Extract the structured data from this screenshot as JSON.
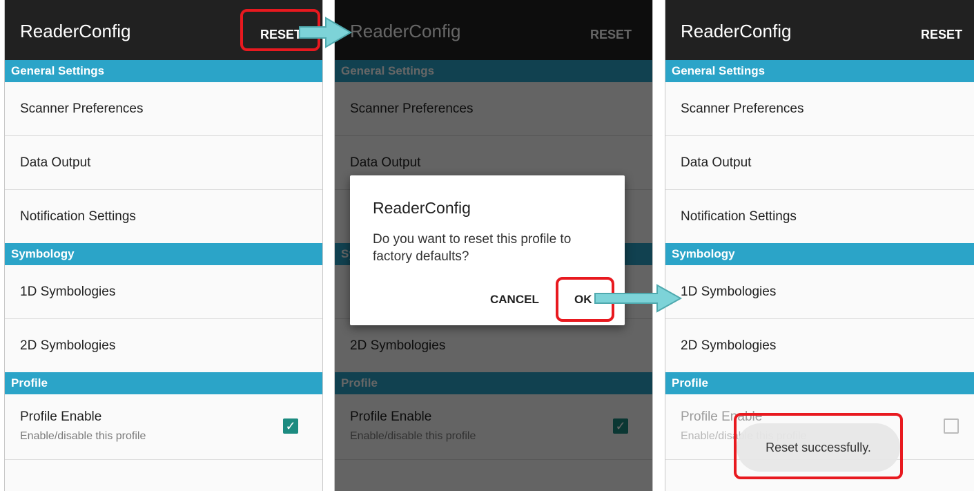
{
  "app": {
    "title": "ReaderConfig",
    "reset_label": "RESET"
  },
  "sections": {
    "general": "General Settings",
    "symbology": "Symbology",
    "profile": "Profile"
  },
  "items": {
    "scanner_preferences": "Scanner Preferences",
    "data_output": "Data Output",
    "notification_settings": "Notification Settings",
    "symbologies_1d": "1D Symbologies",
    "symbologies_2d": "2D Symbologies",
    "profile_enable": "Profile Enable",
    "profile_enable_desc": "Enable/disable this profile"
  },
  "dialog": {
    "title": "ReaderConfig",
    "message": "Do you want to reset this profile to factory defaults?",
    "cancel": "CANCEL",
    "ok": "OK"
  },
  "toast": {
    "message": "Reset successfully."
  },
  "screens": [
    {
      "profile_enabled": true
    },
    {
      "profile_enabled": true
    },
    {
      "profile_enabled": false
    }
  ],
  "colors": {
    "appbar": "#212121",
    "section": "#2ba4c8",
    "checkbox": "#1c8b80",
    "highlight": "#e8191f",
    "arrow": "#7dd3d8"
  },
  "icons": {
    "checked": "check-icon",
    "arrow": "arrow-right-icon"
  }
}
